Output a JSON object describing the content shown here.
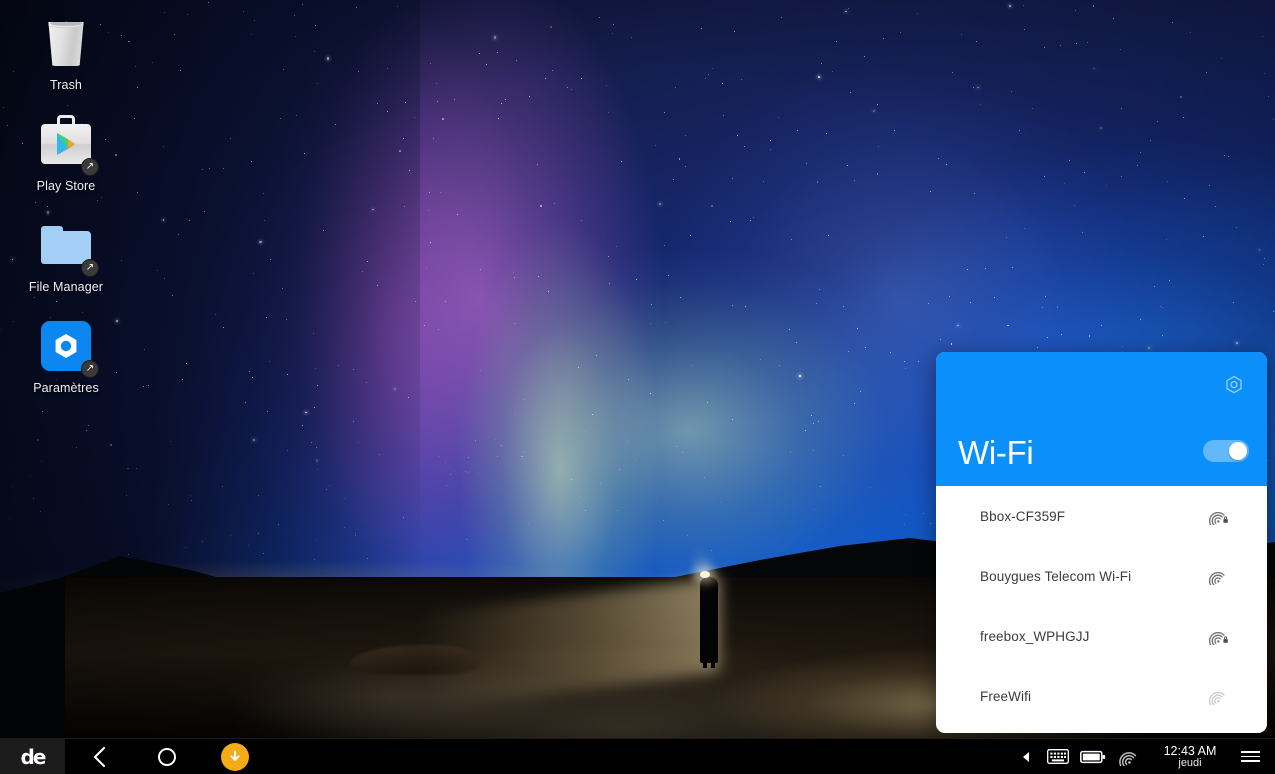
{
  "desktop": {
    "icons": [
      {
        "label": "Trash",
        "icon": "trash-icon",
        "shortcut": false
      },
      {
        "label": "Play Store",
        "icon": "play-store-icon",
        "shortcut": true
      },
      {
        "label": "File Manager",
        "icon": "folder-icon",
        "shortcut": true
      },
      {
        "label": "Paramètres",
        "icon": "settings-gear-icon",
        "shortcut": true
      }
    ],
    "wallpaper_description": "aurora borealis night sky over desert with person holding flashlight"
  },
  "wifi_panel": {
    "title": "Wi-Fi",
    "header_color": "#0b90fb",
    "settings_icon": "gear-icon",
    "toggle": {
      "state": "on",
      "track_color": "#63b8fc",
      "knob_color": "#ffffff"
    },
    "networks": [
      {
        "ssid": "Bbox-CF359F",
        "secured": true,
        "signal_icon": "wifi-signal-lock-icon"
      },
      {
        "ssid": "Bouygues Telecom Wi-Fi",
        "secured": false,
        "signal_icon": "wifi-signal-icon"
      },
      {
        "ssid": "freebox_WPHGJJ",
        "secured": true,
        "signal_icon": "wifi-signal-lock-icon"
      },
      {
        "ssid": "FreeWifi",
        "secured": false,
        "signal_icon": "wifi-signal-icon"
      }
    ]
  },
  "taskbar": {
    "launcher_label": "de",
    "nav": {
      "back_icon": "back-chevron-icon",
      "home_icon": "home-circle-icon",
      "download_icon": "download-arrow-icon",
      "download_badge_color": "#f5ab18"
    },
    "tray": {
      "expand_icon": "tray-expand-triangle-icon",
      "keyboard_icon": "keyboard-icon",
      "battery_icon": "battery-icon",
      "wifi_icon": "wifi-signal-icon",
      "menu_icon": "hamburger-menu-icon"
    },
    "clock": {
      "time": "12:43 AM",
      "day": "jeudi"
    }
  }
}
